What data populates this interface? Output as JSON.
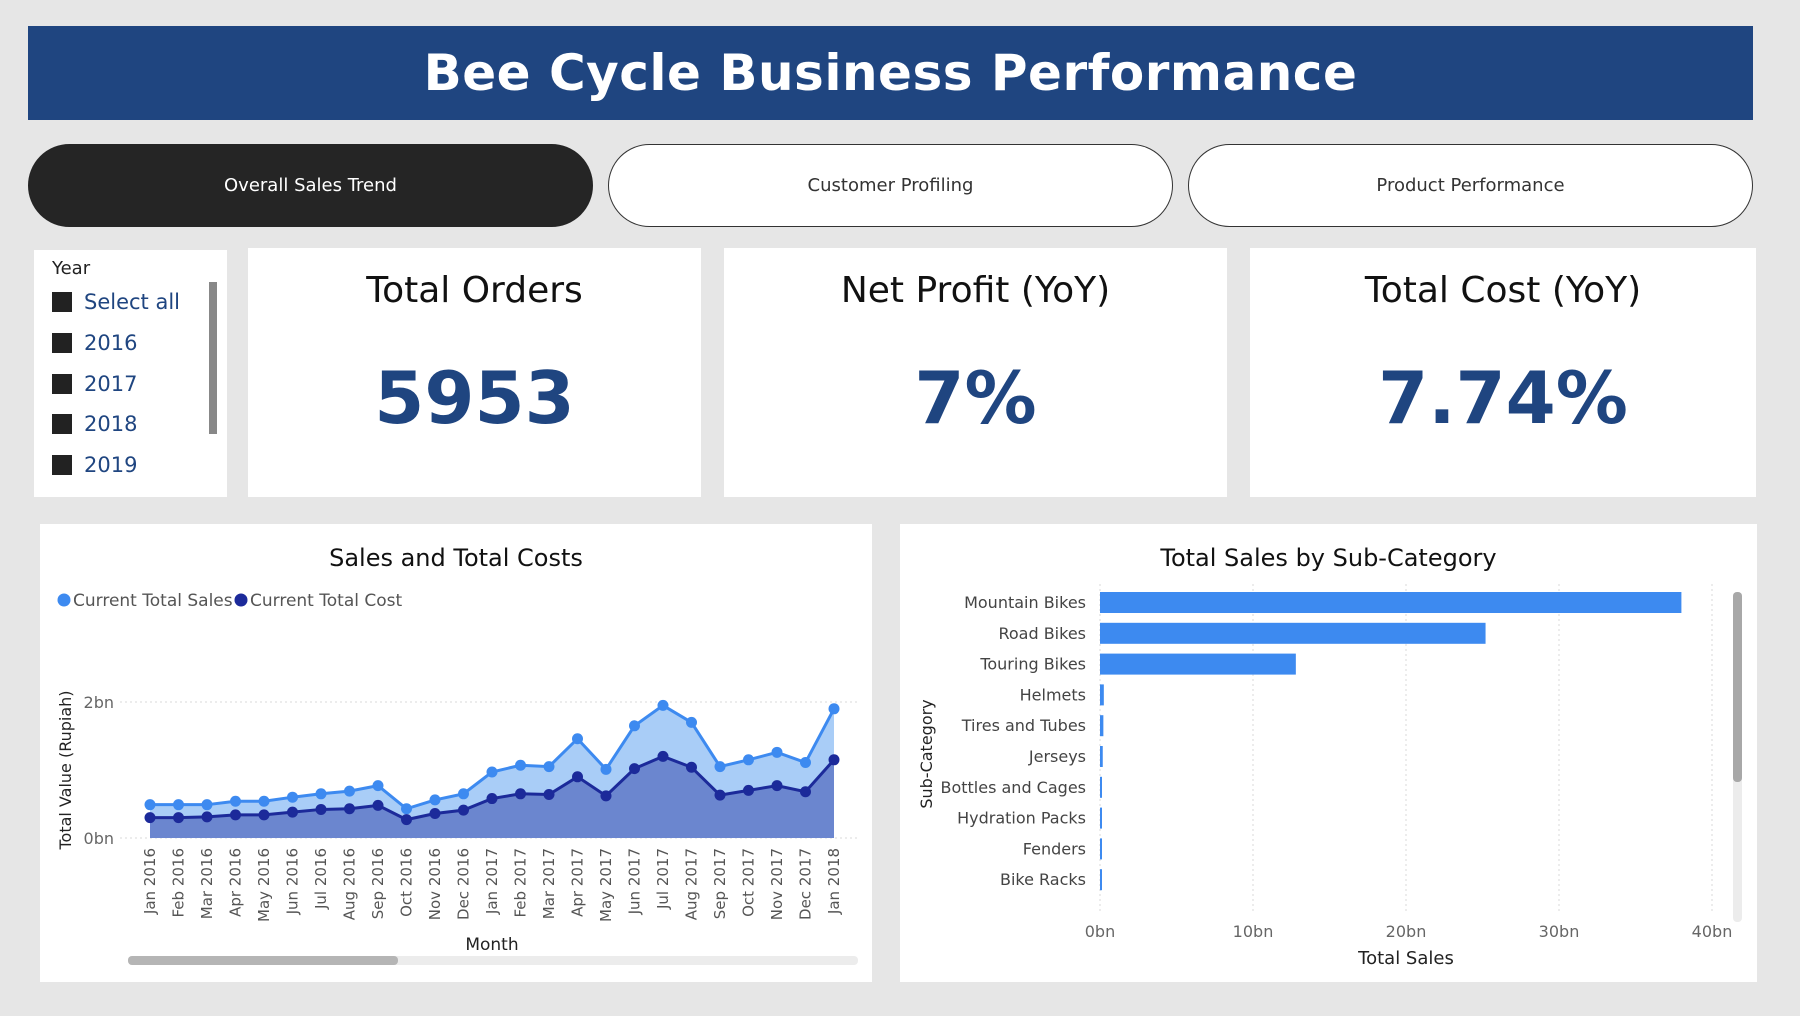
{
  "header": {
    "title": "Bee Cycle Business Performance"
  },
  "tabs": [
    {
      "label": "Overall Sales Trend",
      "active": true
    },
    {
      "label": "Customer Profiling",
      "active": false
    },
    {
      "label": "Product Performance",
      "active": false
    }
  ],
  "year_slicer": {
    "title": "Year",
    "items": [
      "Select all",
      "2016",
      "2017",
      "2018",
      "2019"
    ]
  },
  "kpis": {
    "total_orders": {
      "title": "Total Orders",
      "value": "5953"
    },
    "net_profit": {
      "title": "Net Profit (YoY)",
      "value": "7%"
    },
    "total_cost": {
      "title": "Total Cost (YoY)",
      "value": "7.74%"
    }
  },
  "colors": {
    "brand": "#1f4580",
    "sales": "#3d8af0",
    "sales_fill": "#a9cdf7",
    "cost": "#1c2a9a",
    "cost_fill": "#6b86cf",
    "bar": "#3d8af0"
  },
  "chart_data": [
    {
      "type": "area",
      "title": "Sales and Total Costs",
      "xlabel": "Month",
      "ylabel": "Total Value (Rupiah)",
      "yticks": [
        "0bn",
        "2bn"
      ],
      "ylim": [
        0,
        2.6
      ],
      "legend_position": "top-left",
      "categories": [
        "Jan 2016",
        "Feb 2016",
        "Mar 2016",
        "Apr 2016",
        "May 2016",
        "Jun 2016",
        "Jul 2016",
        "Aug 2016",
        "Sep 2016",
        "Oct 2016",
        "Nov 2016",
        "Dec 2016",
        "Jan 2017",
        "Feb 2017",
        "Mar 2017",
        "Apr 2017",
        "May 2017",
        "Jun 2017",
        "Jul 2017",
        "Aug 2017",
        "Sep 2017",
        "Oct 2017",
        "Nov 2017",
        "Dec 2017",
        "Jan 2018"
      ],
      "series": [
        {
          "name": "Current Total Sales",
          "values": [
            0.49,
            0.49,
            0.49,
            0.54,
            0.54,
            0.6,
            0.65,
            0.69,
            0.77,
            0.43,
            0.56,
            0.65,
            0.97,
            1.07,
            1.05,
            1.46,
            1.01,
            1.65,
            1.95,
            1.7,
            1.05,
            1.15,
            1.26,
            1.11,
            1.9
          ]
        },
        {
          "name": "Current Total Cost",
          "values": [
            0.3,
            0.3,
            0.31,
            0.34,
            0.34,
            0.38,
            0.42,
            0.43,
            0.48,
            0.27,
            0.36,
            0.41,
            0.58,
            0.65,
            0.64,
            0.9,
            0.62,
            1.02,
            1.2,
            1.04,
            0.63,
            0.7,
            0.77,
            0.68,
            1.15
          ]
        }
      ]
    },
    {
      "type": "bar",
      "orientation": "horizontal",
      "title": "Total Sales by Sub-Category",
      "xlabel": "Total Sales",
      "ylabel": "Sub-Category",
      "xticks": [
        "0bn",
        "10bn",
        "20bn",
        "30bn",
        "40bn"
      ],
      "xlim": [
        0,
        40
      ],
      "categories": [
        "Mountain Bikes",
        "Road Bikes",
        "Touring Bikes",
        "Helmets",
        "Tires and Tubes",
        "Jerseys",
        "Bottles and Cages",
        "Hydration Packs",
        "Fenders",
        "Bike Racks"
      ],
      "values": [
        38.0,
        25.2,
        12.8,
        0.25,
        0.22,
        0.18,
        0.07,
        0.05,
        0.05,
        0.04
      ]
    }
  ]
}
